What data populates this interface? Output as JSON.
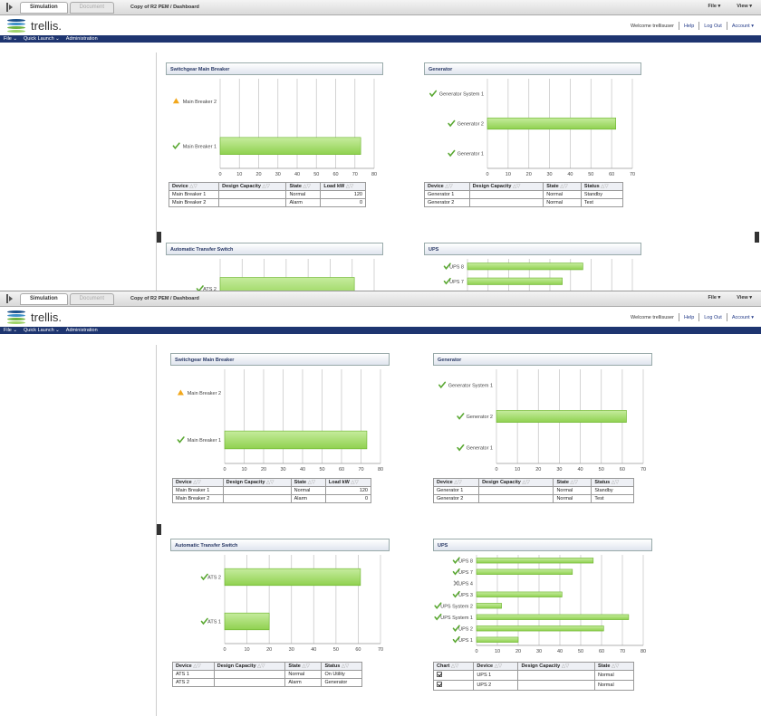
{
  "toolbar": {
    "tab_simulation": "Simulation",
    "tab_document": "Document",
    "breadcrumb": "Copy of R2 PEM / Dashboard",
    "file_menu": "File ▾",
    "view_menu": "View ▾"
  },
  "header": {
    "brand": "trellis.",
    "welcome": "Welcome trellisuser",
    "help": "Help",
    "logout": "Log Out",
    "account": "Account ▾",
    "logo_colors": [
      "#1a4f8a",
      "#3c8fc8",
      "#6cb33e",
      "#9fd36a"
    ]
  },
  "menubar": {
    "file": "File ⌄",
    "quick_launch": "Quick Launch ⌄",
    "administration": "Administration"
  },
  "colors": {
    "bar": "#8fd14f",
    "bar_dark": "#6ab22b",
    "grid": "#c9c9c9",
    "check": "#5aa832",
    "warn": "#f2a71b",
    "menubar": "#1e3570"
  },
  "panels": {
    "switchgear": {
      "title": "Switchgear Main Breaker"
    },
    "generator": {
      "title": "Generator"
    },
    "ats": {
      "title": "Automatic Transfer Switch"
    },
    "ups": {
      "title": "UPS"
    }
  },
  "tables": {
    "switchgear": {
      "headers": [
        "Device",
        "Design Capacity",
        "State",
        "Load kW"
      ],
      "rows": [
        [
          "Main Breaker 1",
          "",
          "Normal",
          "120"
        ],
        [
          "Main Breaker 2",
          "",
          "Alarm",
          "0"
        ]
      ]
    },
    "generator": {
      "headers": [
        "Device",
        "Design Capacity",
        "State",
        "Status"
      ],
      "rows": [
        [
          "Generator 1",
          "",
          "Normal",
          "Standby"
        ],
        [
          "Generator 2",
          "",
          "Normal",
          "Test"
        ]
      ]
    },
    "ats": {
      "headers": [
        "Device",
        "Design Capacity",
        "State",
        "Status"
      ],
      "rows": [
        [
          "ATS 1",
          "",
          "Normal",
          "On Utility"
        ],
        [
          "ATS 2",
          "",
          "Alarm",
          "Generator"
        ]
      ]
    },
    "ups": {
      "headers": [
        "Chart",
        "Device",
        "Design Capacity",
        "State"
      ],
      "rows": [
        [
          "",
          "UPS 1",
          "",
          "Normal"
        ],
        [
          "",
          "UPS 2",
          "",
          "Normal"
        ]
      ]
    }
  },
  "chart_data": [
    {
      "id": "switchgear",
      "type": "bar",
      "orientation": "horizontal",
      "categories": [
        "Main Breaker 2",
        "Main Breaker 1"
      ],
      "status": [
        "warning",
        "ok"
      ],
      "values": [
        0,
        73
      ],
      "xticks": [
        0,
        10,
        20,
        30,
        40,
        50,
        60,
        70,
        80
      ],
      "xlim": [
        0,
        80
      ],
      "grid": true
    },
    {
      "id": "generator",
      "type": "bar",
      "orientation": "horizontal",
      "categories": [
        "Generator System 1",
        "Generator 2",
        "Generator 1"
      ],
      "status": [
        "ok",
        "ok",
        "ok"
      ],
      "values": [
        0,
        62,
        0
      ],
      "xticks": [
        0,
        10,
        20,
        30,
        40,
        50,
        60,
        70
      ],
      "xlim": [
        0,
        70
      ],
      "grid": true
    },
    {
      "id": "ats",
      "type": "bar",
      "orientation": "horizontal",
      "categories": [
        "ATS 2",
        "ATS 1"
      ],
      "status": [
        "ok",
        "ok"
      ],
      "values": [
        61,
        20
      ],
      "xticks": [
        0,
        10,
        20,
        30,
        40,
        50,
        60,
        70
      ],
      "xlim": [
        0,
        70
      ],
      "grid": true
    },
    {
      "id": "ups",
      "type": "bar",
      "orientation": "horizontal",
      "categories": [
        "UPS 8",
        "UPS 7",
        "UPS 4",
        "UPS 3",
        "UPS System 2",
        "UPS System 1",
        "UPS 2",
        "UPS 1"
      ],
      "status": [
        "ok",
        "ok",
        "error",
        "ok",
        "ok",
        "ok",
        "ok",
        "ok"
      ],
      "values": [
        56,
        46,
        0,
        41,
        12,
        73,
        61,
        20
      ],
      "xticks": [
        0,
        10,
        20,
        30,
        40,
        50,
        60,
        70,
        80
      ],
      "xlim": [
        0,
        80
      ],
      "grid": true
    }
  ]
}
